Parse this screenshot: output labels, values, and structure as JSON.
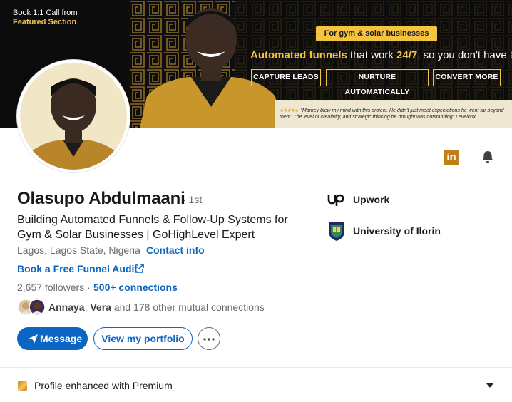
{
  "banner": {
    "top_left_line1": "Book 1:1 Call from",
    "top_left_line2": "Featured Section",
    "gold_tag": "For gym & solar businesses",
    "headline_a": "Automated funnels",
    "headline_b": " that work ",
    "headline_c": "24/7",
    "headline_d": ", so you don't have to",
    "buttons": [
      "CAPTURE LEADS",
      "NURTURE AUTOMATICALLY",
      "CONVERT MORE"
    ],
    "testimonial_stars": "★★★★★",
    "testimonial": "\"Marney blew my mind with this project. He didn't just meet expectations he went far beyond them. The level of creativity, and strategic thinking he brought was outstanding\" Levelorix",
    "accent_color": "#f4c33f"
  },
  "profile": {
    "name": "Olasupo Abdulmaani",
    "degree": "· 1st",
    "headline": "Building Automated Funnels & Follow-Up Systems for Gym & Solar Businesses | GoHighLevel Expert",
    "location": "Lagos, Lagos State, Nigeria",
    "contact_dot": "·",
    "contact_info": "Contact info",
    "website_link": "Book a Free Funnel Audit",
    "followers": "2,657 followers ·",
    "connections": "500+ connections",
    "mutual_name_1": "Annaya",
    "mutual_sep": ", ",
    "mutual_name_2": "Vera",
    "mutual_rest": " and 178 other mutual connections"
  },
  "right_column": {
    "orgs": [
      {
        "name": "Upwork",
        "icon": "upwork-logo-icon"
      },
      {
        "name": "University of Ilorin",
        "icon": "university-crest-icon"
      }
    ]
  },
  "actions": {
    "message": "Message",
    "portfolio": "View my portfolio",
    "more": "more-options"
  },
  "footer": {
    "premium_text": "Profile enhanced with Premium"
  },
  "icons": {
    "linkedin": "in",
    "bell": "bell-icon",
    "external": "external-link-icon",
    "caret": "caret-down-icon"
  },
  "colors": {
    "link_blue": "#0a66c2",
    "premium_gold": "#c37d16"
  }
}
